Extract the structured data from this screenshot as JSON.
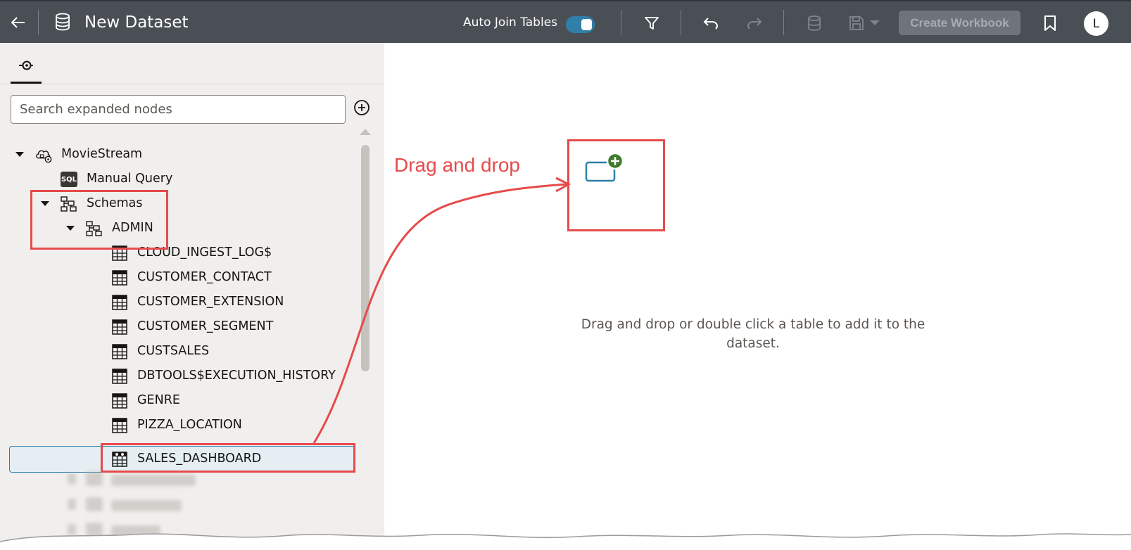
{
  "header": {
    "title": "New Dataset",
    "auto_join_label": "Auto Join Tables",
    "auto_join_on": true,
    "create_workbook_label": "Create Workbook",
    "avatar_initial": "L",
    "accent_color": "#2f7fa8",
    "icons": [
      "back-arrow-icon",
      "dataset-icon",
      "filter-icon",
      "undo-icon",
      "redo-icon",
      "database-icon",
      "save-icon",
      "bookmark-icon"
    ]
  },
  "sidebar": {
    "tab_icon": "connections-icon",
    "search": {
      "placeholder": "Search expanded nodes",
      "value": ""
    },
    "add_icon": "add-circle-icon",
    "tree": {
      "connection": {
        "label": "MovieStream",
        "icon": "cloud-connection-icon"
      },
      "manual_query": {
        "label": "Manual Query",
        "icon": "sql-icon",
        "badge": "SQL"
      },
      "schemas": {
        "label": "Schemas",
        "icon": "schema-icon"
      },
      "admin": {
        "label": "ADMIN",
        "icon": "schema-icon"
      },
      "tables": [
        {
          "label": "CLOUD_INGEST_LOG$"
        },
        {
          "label": "CUSTOMER_CONTACT"
        },
        {
          "label": "CUSTOMER_EXTENSION"
        },
        {
          "label": "CUSTOMER_SEGMENT"
        },
        {
          "label": "CUSTSALES"
        },
        {
          "label": "DBTOOLS$EXECUTION_HISTORY"
        },
        {
          "label": "GENRE"
        },
        {
          "label": "PIZZA_LOCATION"
        },
        {
          "label": "SALES_DASHBOARD",
          "selected": true,
          "icon": "view-icon"
        }
      ]
    }
  },
  "canvas": {
    "hint_line1": "Drag and drop or double click a table to add it to the",
    "hint_line2": "dataset.",
    "add_icon": "add-table-icon"
  },
  "annotation": {
    "label": "Drag and drop",
    "color": "#e64b4b"
  }
}
